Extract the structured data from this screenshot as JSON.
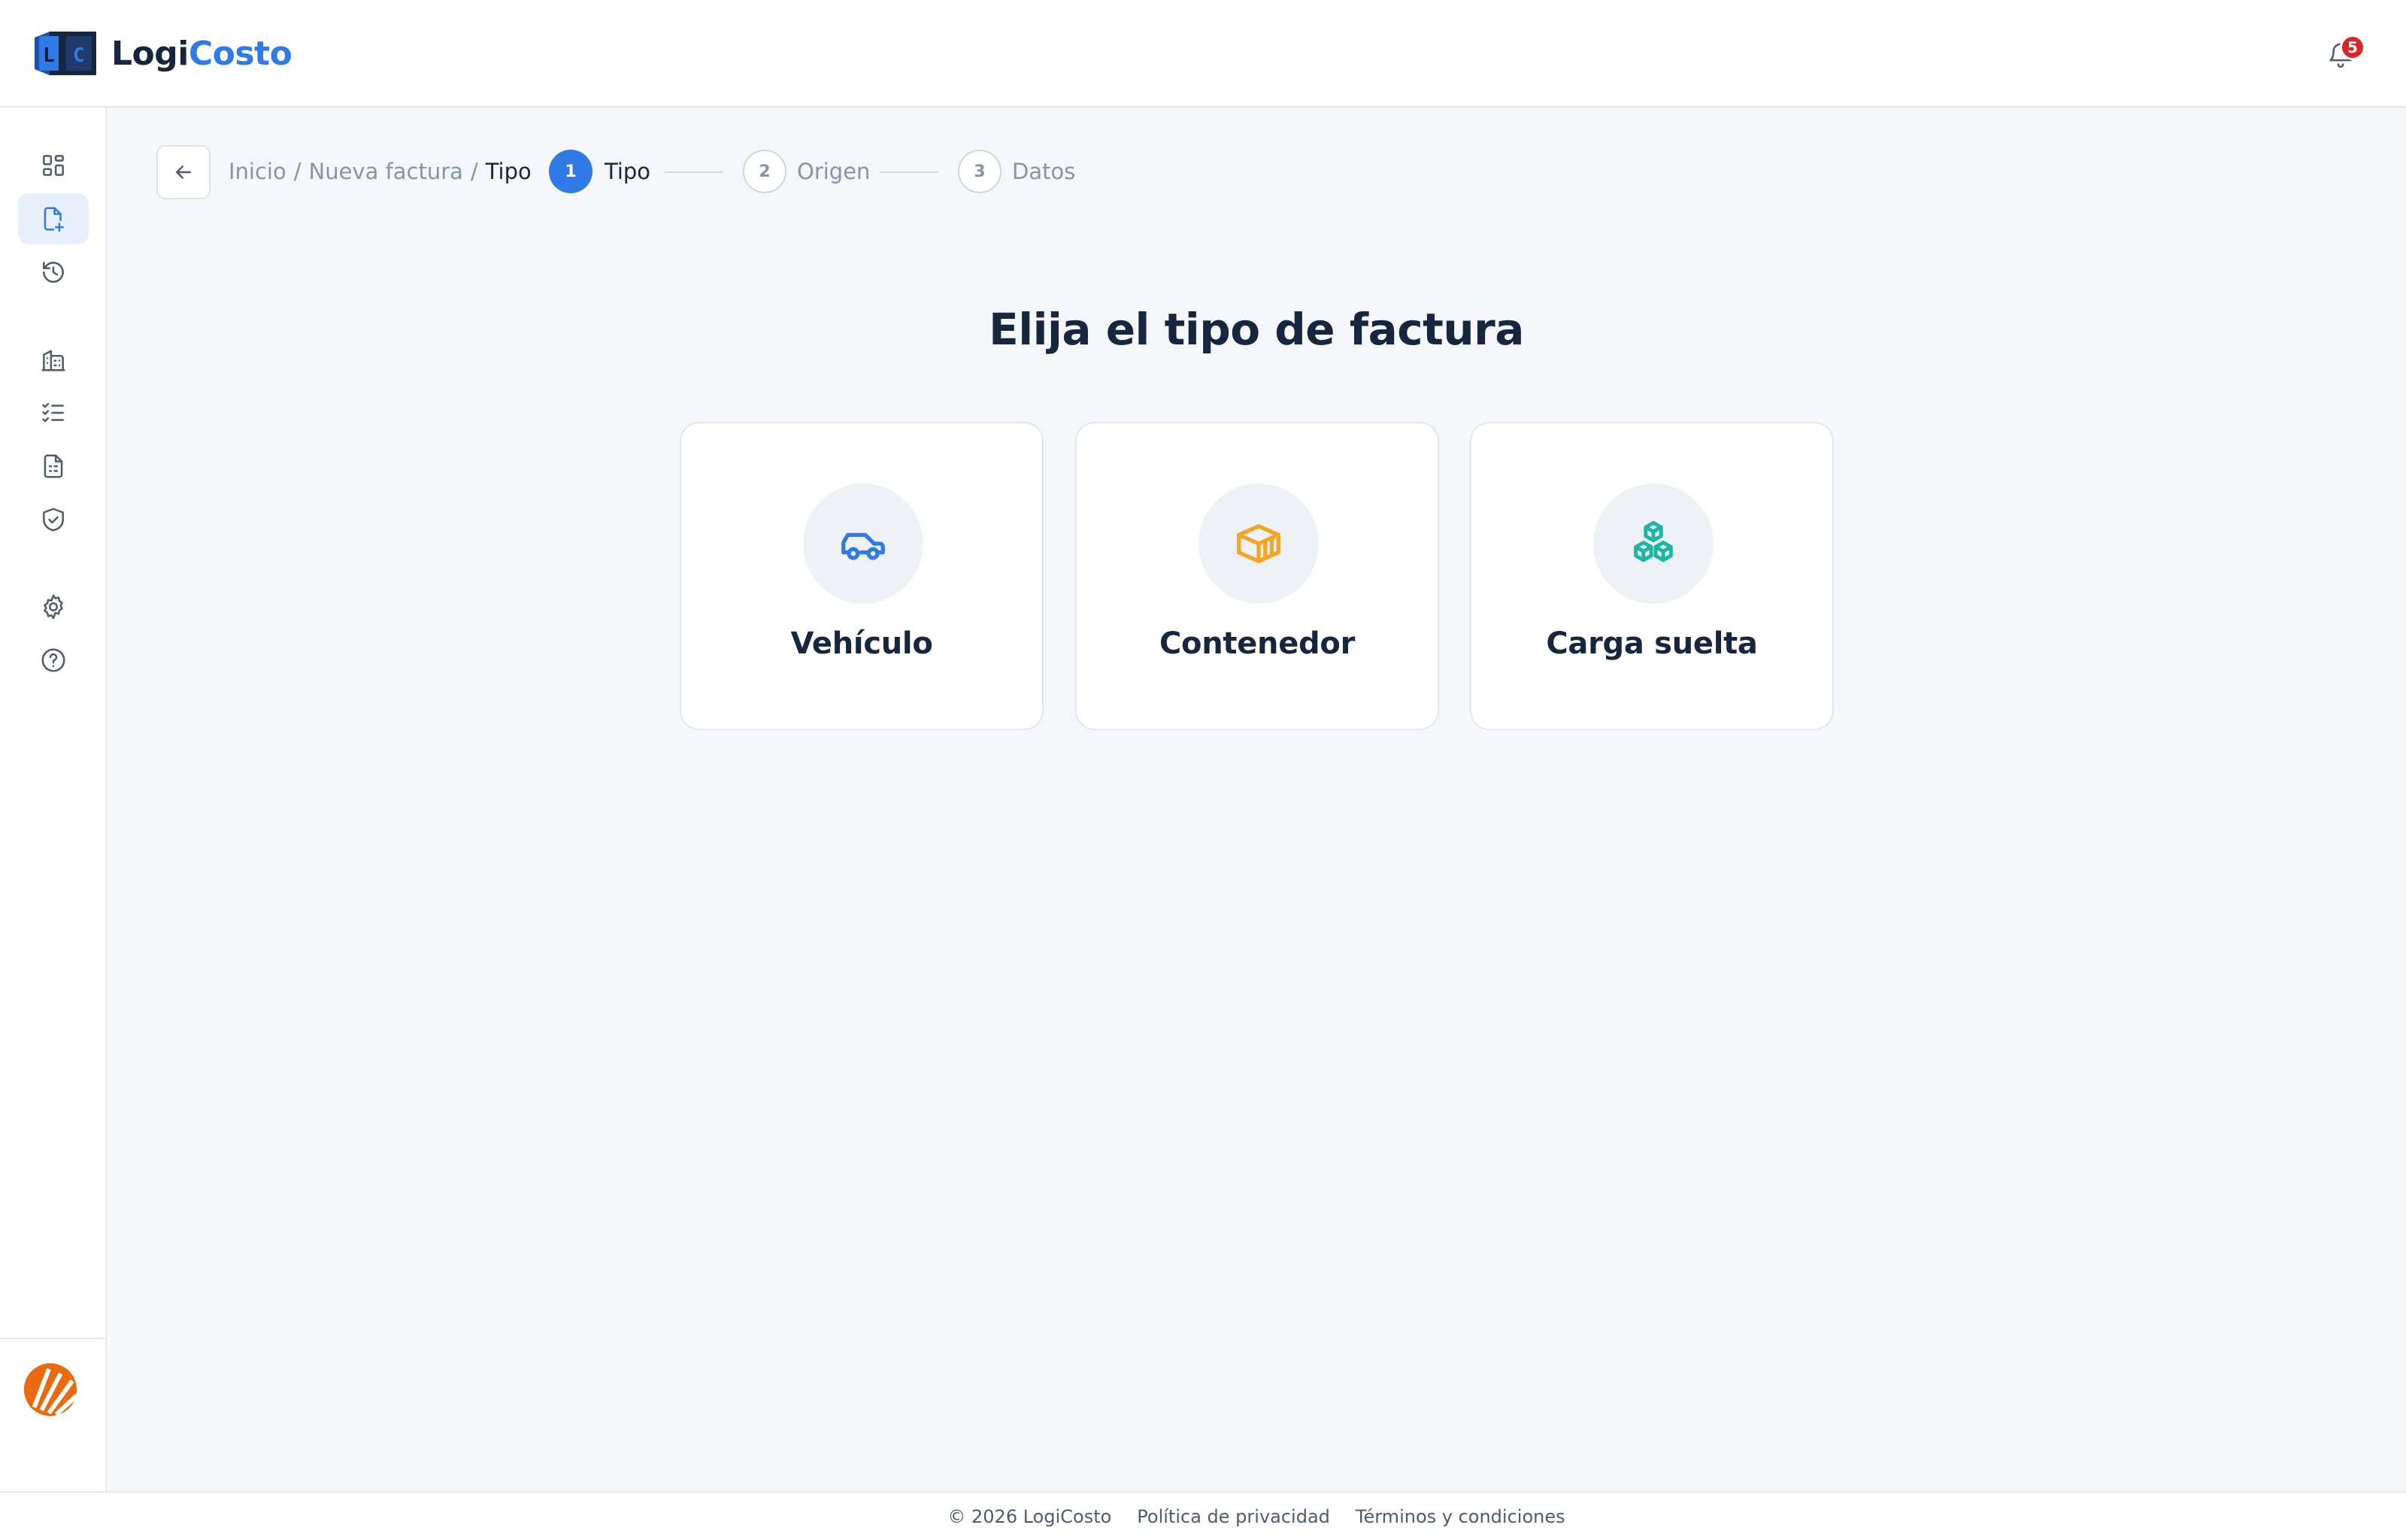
{
  "brand": {
    "name_part1": "Logi",
    "name_part2": "Costo",
    "mark_letters": [
      "L",
      "C"
    ]
  },
  "header": {
    "notification_count": "5"
  },
  "sidebar": {
    "items": [
      {
        "name": "dashboard",
        "icon": "grid-icon",
        "active": false
      },
      {
        "name": "new-invoice",
        "icon": "file-plus-icon",
        "active": true
      },
      {
        "name": "history",
        "icon": "history-icon",
        "active": false
      },
      {
        "name": "companies",
        "icon": "building-icon",
        "active": false
      },
      {
        "name": "checklist",
        "icon": "list-check-icon",
        "active": false
      },
      {
        "name": "reports",
        "icon": "file-text-icon",
        "active": false
      },
      {
        "name": "security",
        "icon": "shield-check-icon",
        "active": false
      },
      {
        "name": "settings",
        "icon": "gear-icon",
        "active": false
      },
      {
        "name": "help",
        "icon": "help-circle-icon",
        "active": false
      }
    ]
  },
  "breadcrumb": {
    "home": "Inicio",
    "section": "Nueva factura",
    "current": "Tipo",
    "separator": "/"
  },
  "stepper": {
    "steps": [
      {
        "number": "1",
        "label": "Tipo",
        "active": true
      },
      {
        "number": "2",
        "label": "Origen",
        "active": false
      },
      {
        "number": "3",
        "label": "Datos",
        "active": false
      }
    ]
  },
  "main": {
    "title": "Elija el tipo de factura",
    "options": [
      {
        "label": "Vehículo",
        "icon": "car-icon",
        "color": "#2f7ae5"
      },
      {
        "label": "Contenedor",
        "icon": "container-icon",
        "color": "#f5a524"
      },
      {
        "label": "Carga suelta",
        "icon": "boxes-icon",
        "color": "#1db5a5"
      }
    ]
  },
  "footer": {
    "copyright": "© 2026 LogiCosto",
    "privacy": "Política de privacidad",
    "terms": "Términos y condiciones"
  },
  "colors": {
    "accent": "#2f7ae5",
    "text": "#17263f",
    "muted": "#8794a8",
    "badge": "#dc2626",
    "background": "#f4f6fa"
  }
}
